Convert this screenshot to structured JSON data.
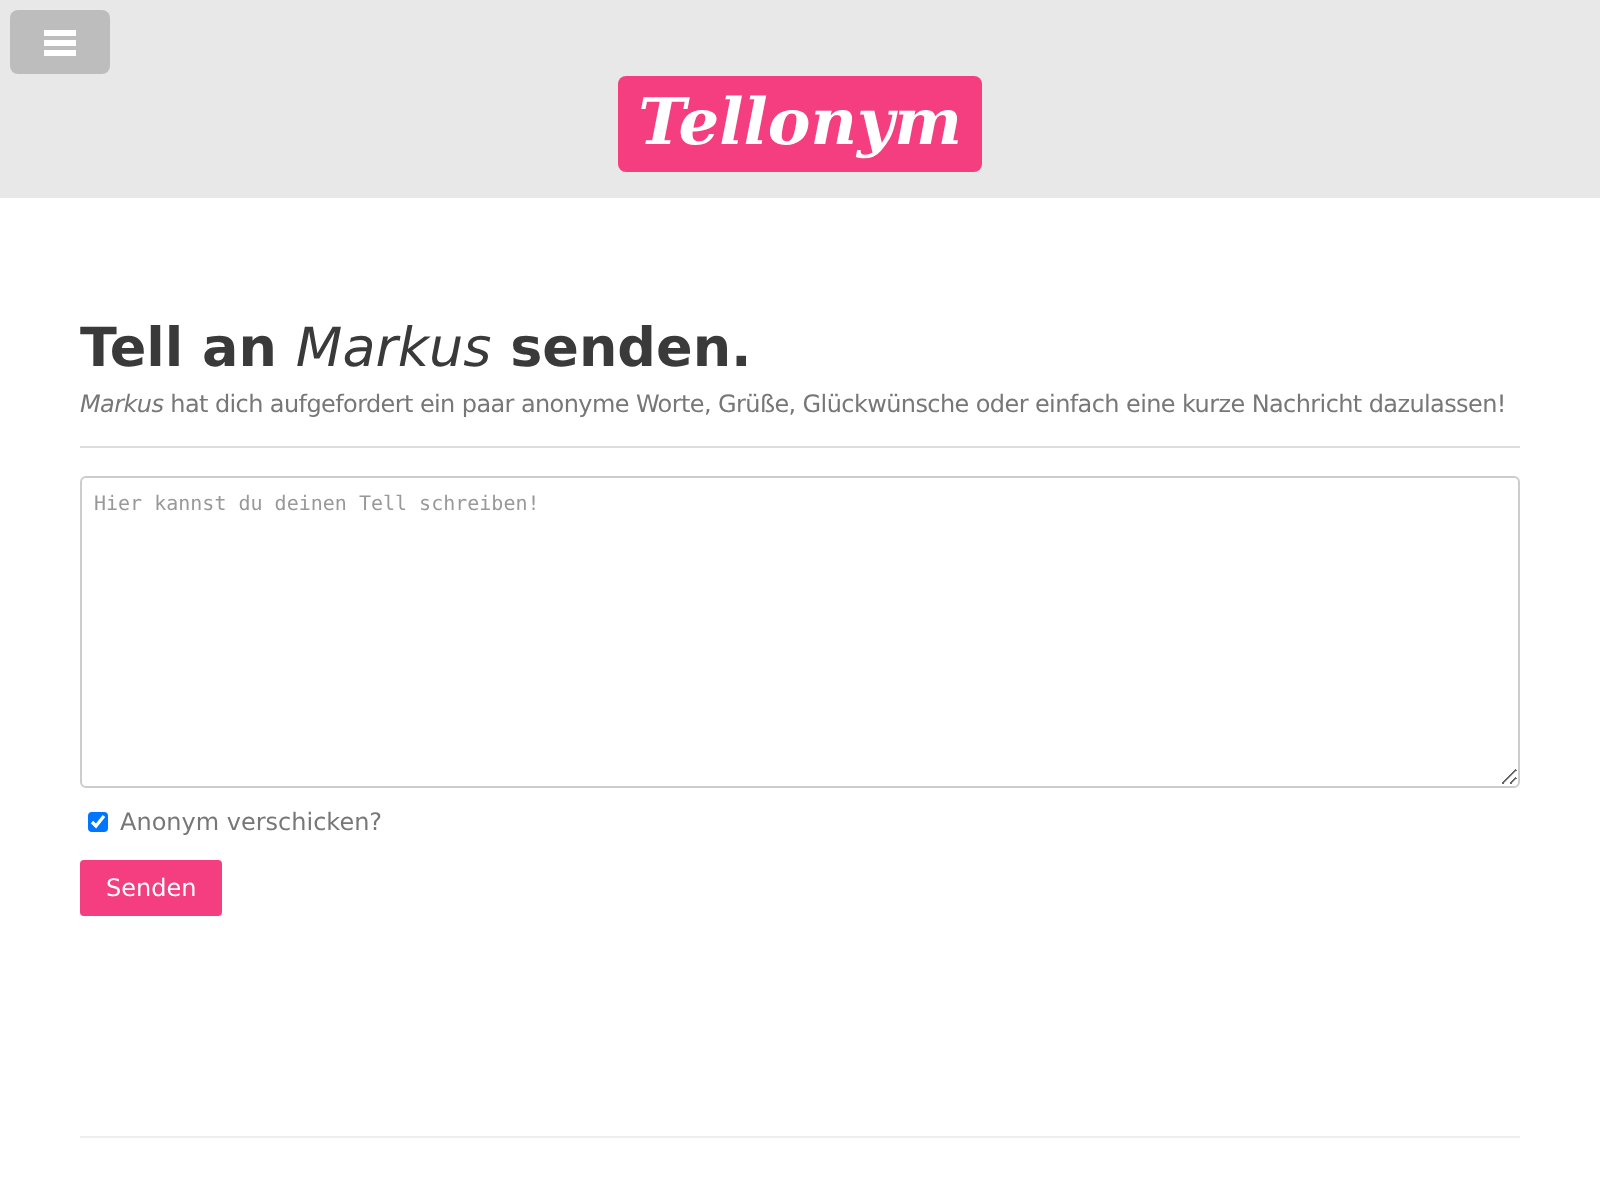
{
  "header": {
    "logo": "Tellonym"
  },
  "heading": "Tell an *Markus* senden.",
  "subtitle": "*Markus* hat dich aufgefordert ein paar anonyme Worte, Grüße, Glückwünsche oder einfach eine kurze Nachricht dazulassen!",
  "message": {
    "placeholder": "Hier kannst du deinen Tell schreiben!"
  },
  "anonymous": {
    "label": "Anonym verschicken?",
    "checked": true
  },
  "submit": "Senden"
}
